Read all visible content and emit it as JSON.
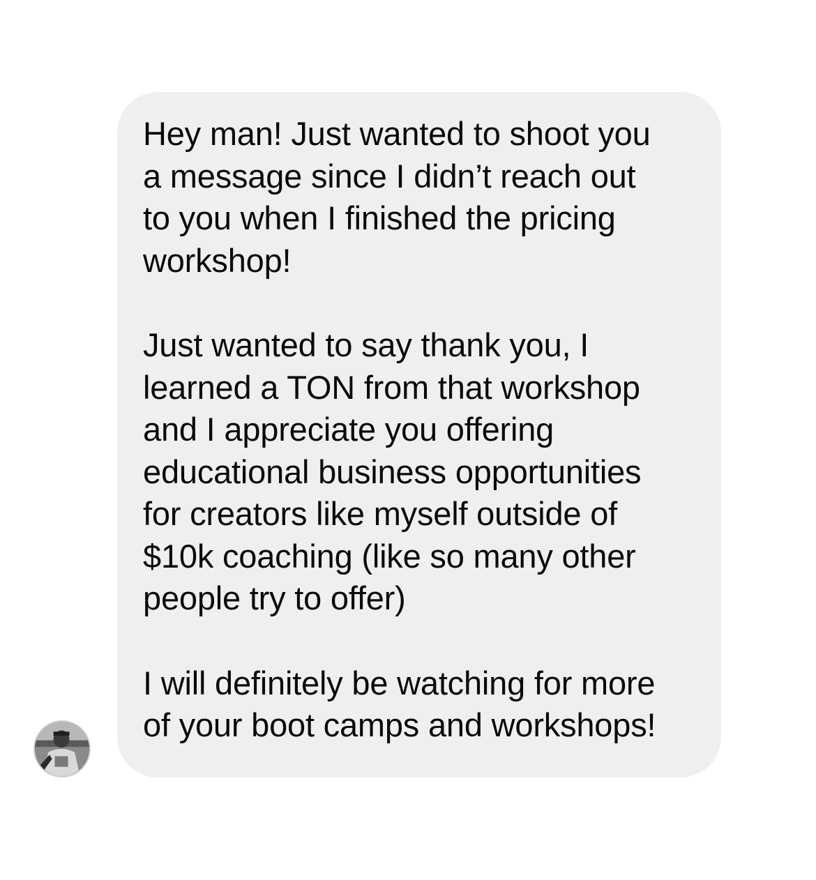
{
  "message": {
    "paragraphs": [
      "Hey man! Just wanted to shoot you\na message since I didn’t reach out\nto you when I finished the pricing\nworkshop!",
      "Just wanted to say thank you, I\nlearned a TON from that workshop\nand I appreciate you offering\neducational business opportunities\nfor creators like myself outside of\n$10k coaching (like so many other\npeople try to offer)",
      "I will definitely be watching for more\nof your boot camps and workshops!"
    ]
  },
  "colors": {
    "bubble_background": "#efefef",
    "text": "#0a0a0a",
    "page_background": "#ffffff"
  },
  "avatar": {
    "icon": "sender-avatar-icon"
  }
}
